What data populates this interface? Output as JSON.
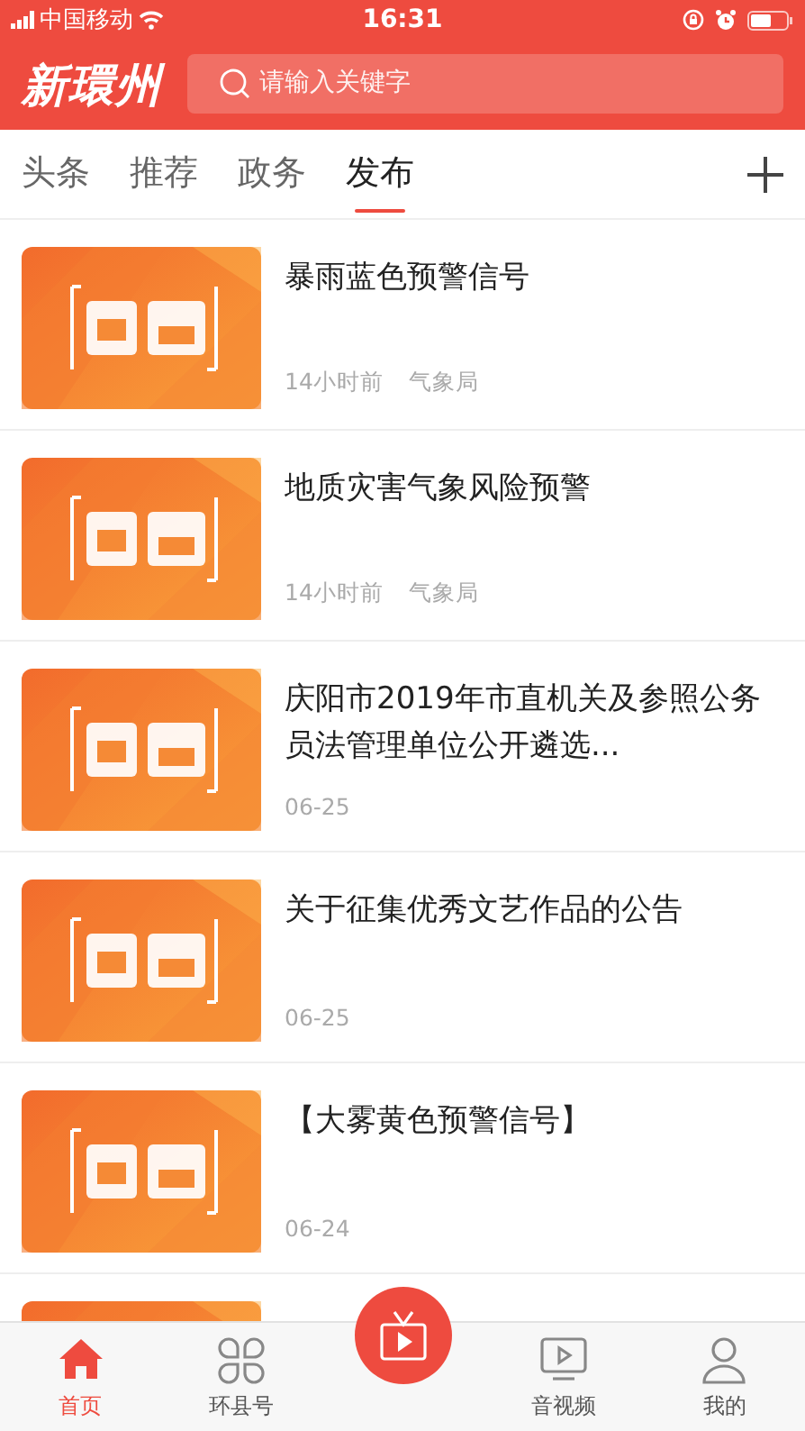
{
  "status_bar": {
    "carrier": "中国移动",
    "time": "16:31"
  },
  "header": {
    "logo": "新環州",
    "search": {
      "placeholder": "请输入关键字"
    }
  },
  "tabs": [
    {
      "label": "头条",
      "selected": false
    },
    {
      "label": "推荐",
      "selected": false
    },
    {
      "label": "政务",
      "selected": false
    },
    {
      "label": "发布",
      "selected": true
    }
  ],
  "news": [
    {
      "kind": "article",
      "title": "暴雨蓝色预警信号",
      "time": "14小时前",
      "source": "气象局"
    },
    {
      "kind": "article",
      "title": "地质灾害气象风险预警",
      "time": "14小时前",
      "source": "气象局"
    },
    {
      "kind": "article",
      "title": "庆阳市2019年市直机关及参照公务员法管理单位公开遴选...",
      "time": "06-25"
    },
    {
      "kind": "article",
      "title": "关于征集优秀文艺作品的公告",
      "time": "06-25"
    },
    {
      "kind": "article",
      "title": "【大雾黄色预警信号】",
      "time": "06-24"
    },
    {
      "kind": "picture"
    }
  ],
  "bottom_nav": [
    {
      "kind": "home",
      "label": "首页",
      "selected": true
    },
    {
      "kind": "grid",
      "label": "环县号",
      "selected": false
    },
    {
      "kind": "center"
    },
    {
      "kind": "video",
      "label": "音视频",
      "selected": false
    },
    {
      "kind": "person",
      "label": "我的",
      "selected": false
    }
  ]
}
